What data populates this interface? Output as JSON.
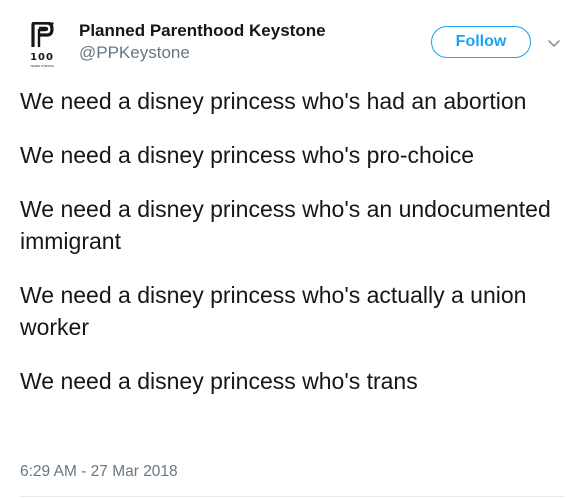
{
  "author": {
    "name": "Planned Parenthood Keystone",
    "handle": "@PPKeystone",
    "avatar_badge": "100",
    "avatar_badge_sub": "YEARS STRONG"
  },
  "actions": {
    "follow_label": "Follow",
    "menu_icon": "chevron-down-icon"
  },
  "tweet": {
    "lines": [
      "We need a disney princess who's had an abortion",
      "We need a disney princess who's pro-choice",
      "We need a disney princess who's an undocumented immigrant",
      "We need a disney princess who's actually a union worker",
      "We need a disney princess who's trans"
    ],
    "timestamp": "6:29 AM - 27 Mar 2018"
  },
  "colors": {
    "accent": "#1da1f2",
    "text": "#14171a",
    "secondary": "#657786"
  }
}
